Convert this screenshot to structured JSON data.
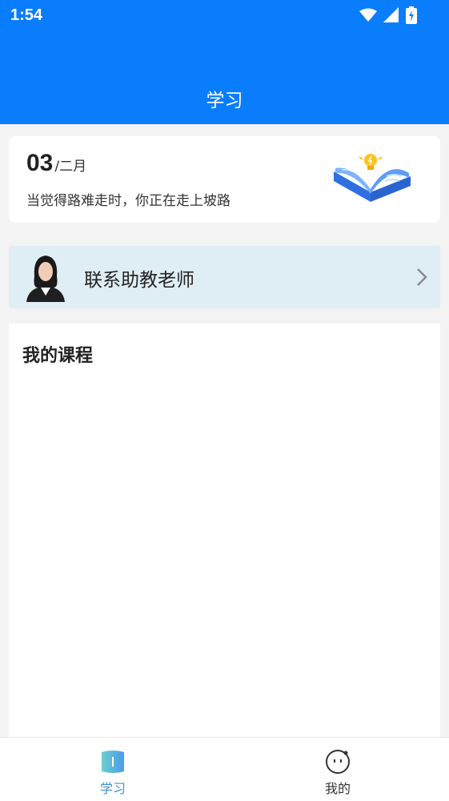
{
  "status_bar": {
    "time": "1:54",
    "icons": [
      "wifi-icon",
      "signal-icon",
      "battery-charging-icon"
    ]
  },
  "header": {
    "title": "学习",
    "background_color": "#0a7dfc"
  },
  "date_card": {
    "day": "03",
    "month": "/二月",
    "quote": "当觉得路难走时，你正在走上坡路",
    "illustration": "open-book-lightbulb-illustration"
  },
  "contact": {
    "label": "联系助教老师",
    "avatar": "teacher-avatar",
    "icon": "chevron-right-icon"
  },
  "courses": {
    "title": "我的课程",
    "items": []
  },
  "bottom_nav": {
    "items": [
      {
        "label": "学习",
        "icon": "study-tab-icon",
        "active": true
      },
      {
        "label": "我的",
        "icon": "smiley-face-icon",
        "active": false
      }
    ],
    "active_color": "#3c8fd6"
  }
}
